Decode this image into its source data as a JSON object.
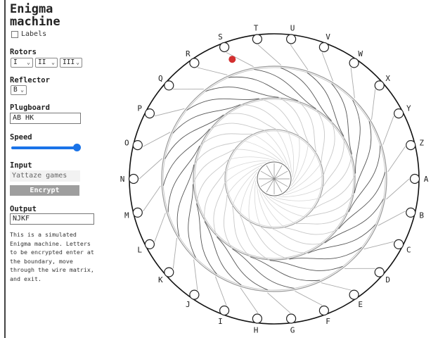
{
  "title_lines": [
    "Enigma",
    "machine"
  ],
  "labels_checkbox": "Labels",
  "rotors": {
    "label": "Rotors",
    "values": [
      "I",
      "II",
      "III"
    ]
  },
  "reflector": {
    "label": "Reflector",
    "value": "B"
  },
  "plugboard": {
    "label": "Plugboard",
    "value": "AB HK"
  },
  "speed": {
    "label": "Speed",
    "level": 0.95
  },
  "input": {
    "label": "Input",
    "value": "Yattaze games"
  },
  "encrypt_label": "Encrypt",
  "output": {
    "label": "Output",
    "value": "NJKF"
  },
  "description_lines": [
    "This is a simulated",
    "Enigma machine. Letters",
    "to be encrypted enter at",
    "the boundary, move",
    "through the wire matrix,",
    "and exit."
  ],
  "letters": [
    "A",
    "B",
    "C",
    "D",
    "E",
    "F",
    "G",
    "H",
    "I",
    "J",
    "K",
    "L",
    "M",
    "N",
    "O",
    "P",
    "Q",
    "R",
    "S",
    "T",
    "U",
    "V",
    "W",
    "X",
    "Y",
    "Z"
  ],
  "colors": {
    "accent": "#1a73e8",
    "active_dot": "#d32f2f",
    "button": "#9e9e9e"
  }
}
